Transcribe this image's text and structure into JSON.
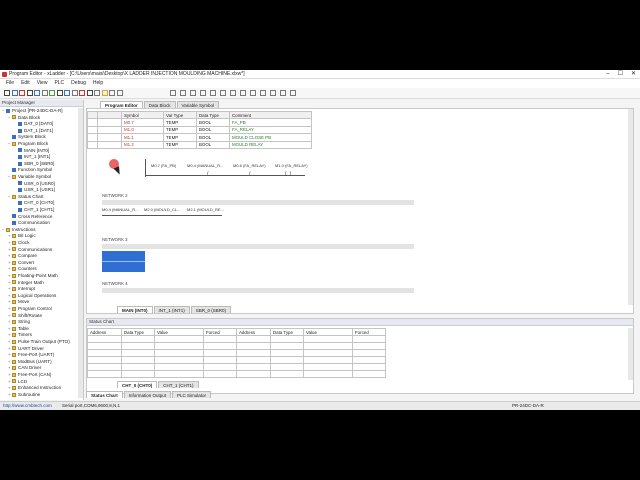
{
  "window": {
    "title": "Program Editor - xLadder - [C:\\Users\\maisi\\Desktop\\X LADDER INJECTION MOULDING MACHINE.xlxw*]",
    "controls": [
      "–",
      "☐",
      "✕"
    ]
  },
  "menu": [
    "File",
    "Edit",
    "View",
    "PLC",
    "Debug",
    "Help"
  ],
  "project": {
    "header": "Project Manager",
    "items": [
      {
        "label": "Project [PR-24DC-DA-R]",
        "indent": 0,
        "icon": "blk",
        "ex": "−"
      },
      {
        "label": "Data Block",
        "indent": 1,
        "icon": "fold",
        "ex": "−"
      },
      {
        "label": "DAT_0 [DAT0]",
        "indent": 2,
        "icon": "blk",
        "ex": ""
      },
      {
        "label": "DAT_1 [DAT1]",
        "indent": 2,
        "icon": "blk",
        "ex": ""
      },
      {
        "label": "System Block",
        "indent": 1,
        "icon": "blk",
        "ex": ""
      },
      {
        "label": "Program Block",
        "indent": 1,
        "icon": "fold",
        "ex": "−"
      },
      {
        "label": "MAIN [INT0]",
        "indent": 2,
        "icon": "blk",
        "ex": ""
      },
      {
        "label": "INT_1 [INT1]",
        "indent": 2,
        "icon": "blk",
        "ex": ""
      },
      {
        "label": "SBR_0 [SBR0]",
        "indent": 2,
        "icon": "blk",
        "ex": ""
      },
      {
        "label": "Function Symbol",
        "indent": 1,
        "icon": "blk",
        "ex": ""
      },
      {
        "label": "Variable Symbol",
        "indent": 1,
        "icon": "fold",
        "ex": "−"
      },
      {
        "label": "USR_0 [USR0]",
        "indent": 2,
        "icon": "blk",
        "ex": ""
      },
      {
        "label": "USR_1 [USR1]",
        "indent": 2,
        "icon": "blk",
        "ex": ""
      },
      {
        "label": "Status Chart",
        "indent": 1,
        "icon": "fold",
        "ex": "−"
      },
      {
        "label": "CHT_0 [CHT0]",
        "indent": 2,
        "icon": "blk",
        "ex": ""
      },
      {
        "label": "CHT_1 [CHT1]",
        "indent": 2,
        "icon": "blk",
        "ex": ""
      },
      {
        "label": "Cross Reference",
        "indent": 1,
        "icon": "blk",
        "ex": ""
      },
      {
        "label": "Communication",
        "indent": 1,
        "icon": "blk",
        "ex": ""
      },
      {
        "label": "Instructions",
        "indent": 0,
        "icon": "fold",
        "ex": "−"
      },
      {
        "label": "Bit Logic",
        "indent": 1,
        "icon": "fold",
        "ex": "+"
      },
      {
        "label": "Clock",
        "indent": 1,
        "icon": "fold",
        "ex": "+"
      },
      {
        "label": "Communications",
        "indent": 1,
        "icon": "fold",
        "ex": "+"
      },
      {
        "label": "Compare",
        "indent": 1,
        "icon": "fold",
        "ex": "+"
      },
      {
        "label": "Convert",
        "indent": 1,
        "icon": "fold",
        "ex": "+"
      },
      {
        "label": "Counters",
        "indent": 1,
        "icon": "fold",
        "ex": "+"
      },
      {
        "label": "Floating-Point Math",
        "indent": 1,
        "icon": "fold",
        "ex": "+"
      },
      {
        "label": "Integer Math",
        "indent": 1,
        "icon": "fold",
        "ex": "+"
      },
      {
        "label": "Interrupt",
        "indent": 1,
        "icon": "fold",
        "ex": "+"
      },
      {
        "label": "Logical Operations",
        "indent": 1,
        "icon": "fold",
        "ex": "+"
      },
      {
        "label": "Move",
        "indent": 1,
        "icon": "fold",
        "ex": "+"
      },
      {
        "label": "Program Control",
        "indent": 1,
        "icon": "fold",
        "ex": "+"
      },
      {
        "label": "Shift/Rotate",
        "indent": 1,
        "icon": "fold",
        "ex": "+"
      },
      {
        "label": "String",
        "indent": 1,
        "icon": "fold",
        "ex": "+"
      },
      {
        "label": "Table",
        "indent": 1,
        "icon": "fold",
        "ex": "+"
      },
      {
        "label": "Timers",
        "indent": 1,
        "icon": "fold",
        "ex": "+"
      },
      {
        "label": "Pulse Train Output (PTO)",
        "indent": 1,
        "icon": "fold",
        "ex": "+"
      },
      {
        "label": "UART Driver",
        "indent": 1,
        "icon": "fold",
        "ex": "+"
      },
      {
        "label": "Free-Port (UART)",
        "indent": 1,
        "icon": "fold",
        "ex": "+"
      },
      {
        "label": "ModBus (UART)",
        "indent": 1,
        "icon": "fold",
        "ex": "+"
      },
      {
        "label": "CAN Driver",
        "indent": 1,
        "icon": "fold",
        "ex": "+"
      },
      {
        "label": "Free-Port (CAN)",
        "indent": 1,
        "icon": "fold",
        "ex": "+"
      },
      {
        "label": "LCD",
        "indent": 1,
        "icon": "fold",
        "ex": "+"
      },
      {
        "label": "Enhanced Instruction",
        "indent": 1,
        "icon": "fold",
        "ex": "+"
      },
      {
        "label": "Subroutine",
        "indent": 1,
        "icon": "fold",
        "ex": "+"
      }
    ]
  },
  "editor_tabs": [
    "Program Editor",
    "Data Block",
    "Variable Symbol"
  ],
  "symbols": {
    "headers": [
      "Symbol",
      "Var Type",
      "Data Type",
      "Comment"
    ],
    "rows": [
      [
        "M0.7",
        "TEMP",
        "BOOL",
        "FA_PB"
      ],
      [
        "M1.0",
        "TEMP",
        "BOOL",
        "FA_RELAY"
      ],
      [
        "M1.1",
        "TEMP",
        "BOOL",
        "MOULD CLOSE PB"
      ],
      [
        "M1.2",
        "TEMP",
        "BOOL",
        "MOULD RELAY"
      ]
    ]
  },
  "networks": {
    "n1_contacts": [
      "M0.7 (FA_PB)",
      "M0.4 (MANUAL_R...",
      "M0.6 (FA_RELAY)",
      "M1.0 (FA_RELAY)"
    ],
    "n2_label": "NETWORK 2",
    "n2_contacts": [
      "M0.4 (MANUAL_R...",
      "M2.0 (MOULD_CL...",
      "M2.1 (MOULD_RE..."
    ],
    "n3_label": "NETWORK 3",
    "n4_label": "NETWORK 4"
  },
  "program_tabs": [
    "MAIN (INT0)",
    "INT_1 (INT1)",
    "SBR_0 (SBR0)"
  ],
  "status_chart": {
    "header": "Status Chart",
    "headers": [
      "Address",
      "Data Type",
      "Value",
      "Forced",
      "Address",
      "Data Type",
      "Value",
      "Forced"
    ],
    "tabs": [
      "CHT_0 (CHT0)",
      "CHT_1 (CHT1)"
    ]
  },
  "bottom_tabs": [
    "Status Chart",
    "Information Output",
    "PLC Simulator"
  ],
  "statusbar": {
    "link": "http://www.cmbtech.com",
    "port": "Serial port,COM6,9600,8,N,1",
    "model": "PR-24DC-DA-R"
  },
  "colors": {
    "accent": "#3a6fc4",
    "selection": "#2f6fd1",
    "cursor_dot": "#e34a4a"
  }
}
